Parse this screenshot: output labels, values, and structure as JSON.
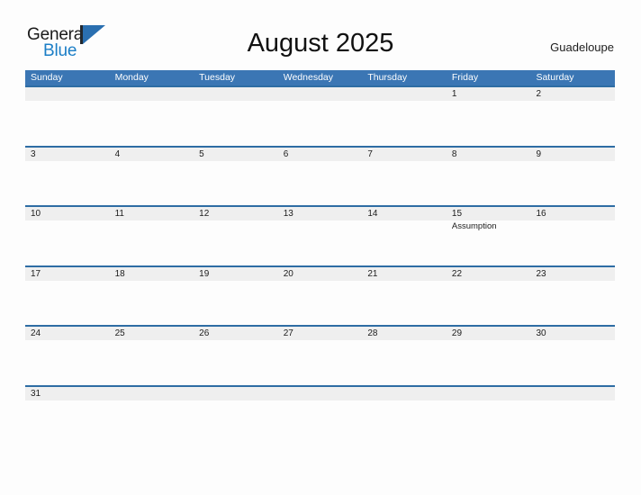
{
  "brand": {
    "word_one": "General",
    "word_two": "Blue",
    "mark": "sail-triangle",
    "color_dark": "#23282d",
    "color_blue": "#2a6fb0",
    "color_light_blue": "#1b7ec6"
  },
  "header": {
    "title": "August 2025",
    "locale": "Guadeloupe"
  },
  "theme": {
    "header_blue": "#3b76b4",
    "rule_blue": "#2e6da4",
    "band_gray": "#efefef",
    "page_bg": "#fdfdfd",
    "text": "#1c1c1c"
  },
  "calendar": {
    "month": "August",
    "year": "2025",
    "weekdays": [
      "Sunday",
      "Monday",
      "Tuesday",
      "Wednesday",
      "Thursday",
      "Friday",
      "Saturday"
    ],
    "weeks": [
      [
        {
          "day": "",
          "event": ""
        },
        {
          "day": "",
          "event": ""
        },
        {
          "day": "",
          "event": ""
        },
        {
          "day": "",
          "event": ""
        },
        {
          "day": "",
          "event": ""
        },
        {
          "day": "1",
          "event": ""
        },
        {
          "day": "2",
          "event": ""
        }
      ],
      [
        {
          "day": "3",
          "event": ""
        },
        {
          "day": "4",
          "event": ""
        },
        {
          "day": "5",
          "event": ""
        },
        {
          "day": "6",
          "event": ""
        },
        {
          "day": "7",
          "event": ""
        },
        {
          "day": "8",
          "event": ""
        },
        {
          "day": "9",
          "event": ""
        }
      ],
      [
        {
          "day": "10",
          "event": ""
        },
        {
          "day": "11",
          "event": ""
        },
        {
          "day": "12",
          "event": ""
        },
        {
          "day": "13",
          "event": ""
        },
        {
          "day": "14",
          "event": ""
        },
        {
          "day": "15",
          "event": "Assumption"
        },
        {
          "day": "16",
          "event": ""
        }
      ],
      [
        {
          "day": "17",
          "event": ""
        },
        {
          "day": "18",
          "event": ""
        },
        {
          "day": "19",
          "event": ""
        },
        {
          "day": "20",
          "event": ""
        },
        {
          "day": "21",
          "event": ""
        },
        {
          "day": "22",
          "event": ""
        },
        {
          "day": "23",
          "event": ""
        }
      ],
      [
        {
          "day": "24",
          "event": ""
        },
        {
          "day": "25",
          "event": ""
        },
        {
          "day": "26",
          "event": ""
        },
        {
          "day": "27",
          "event": ""
        },
        {
          "day": "28",
          "event": ""
        },
        {
          "day": "29",
          "event": ""
        },
        {
          "day": "30",
          "event": ""
        }
      ],
      [
        {
          "day": "31",
          "event": ""
        },
        {
          "day": "",
          "event": ""
        },
        {
          "day": "",
          "event": ""
        },
        {
          "day": "",
          "event": ""
        },
        {
          "day": "",
          "event": ""
        },
        {
          "day": "",
          "event": ""
        },
        {
          "day": "",
          "event": ""
        }
      ]
    ]
  }
}
